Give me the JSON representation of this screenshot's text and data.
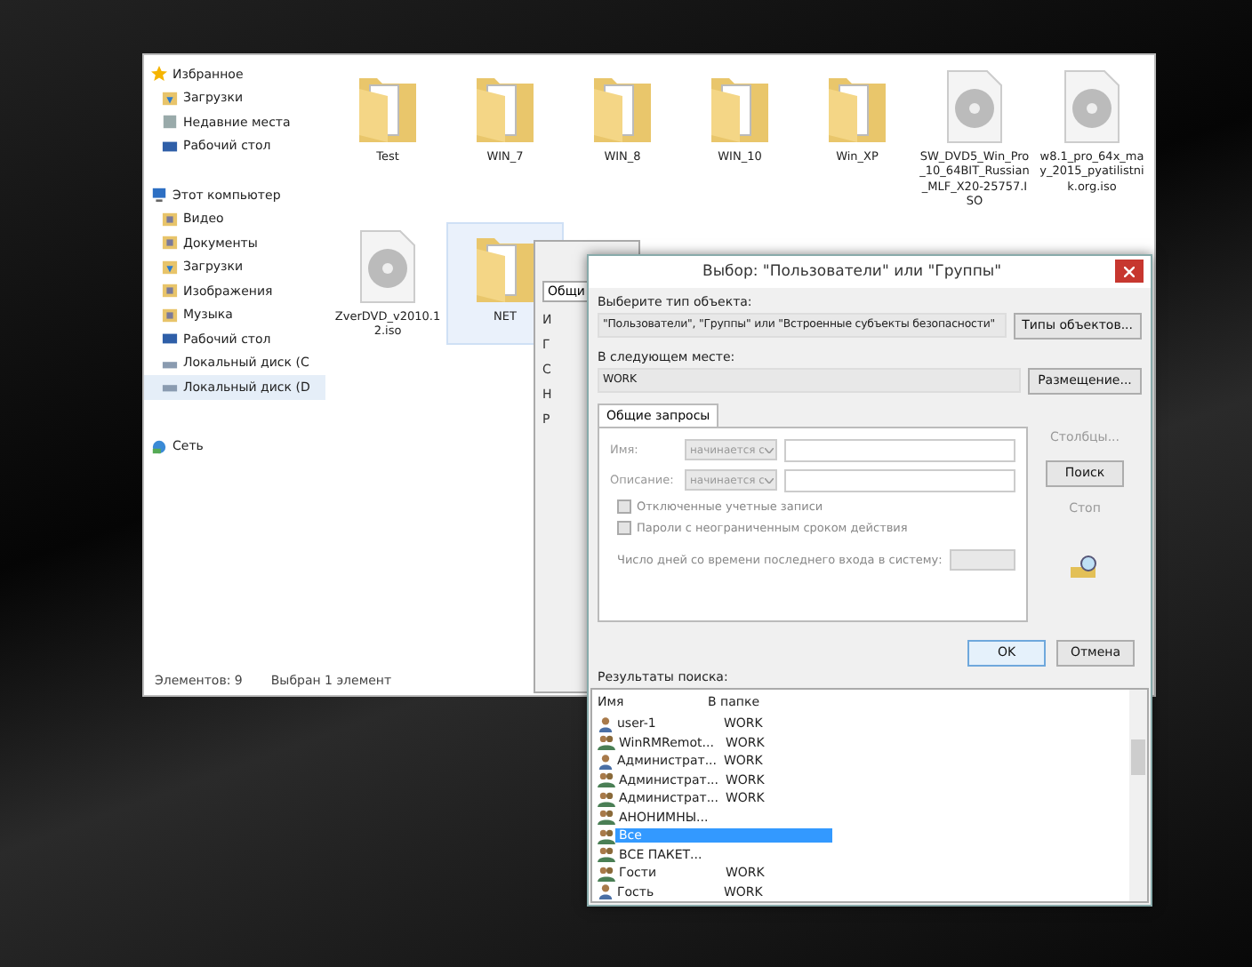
{
  "explorer": {
    "sidebar": [
      {
        "label": "Избранное",
        "kind": "star",
        "group": true,
        "selected": false
      },
      {
        "label": "Загрузки",
        "kind": "download",
        "group": false,
        "selected": false
      },
      {
        "label": "Недавние места",
        "kind": "recent",
        "group": false,
        "selected": false
      },
      {
        "label": "Рабочий стол",
        "kind": "desktop",
        "group": false,
        "selected": false
      },
      {
        "label": "Этот компьютер",
        "kind": "pc",
        "group": true,
        "selected": false
      },
      {
        "label": "Видео",
        "kind": "video",
        "group": false,
        "selected": false
      },
      {
        "label": "Документы",
        "kind": "docs",
        "group": false,
        "selected": false
      },
      {
        "label": "Загрузки",
        "kind": "download",
        "group": false,
        "selected": false
      },
      {
        "label": "Изображения",
        "kind": "images",
        "group": false,
        "selected": false
      },
      {
        "label": "Музыка",
        "kind": "music",
        "group": false,
        "selected": false
      },
      {
        "label": "Рабочий стол",
        "kind": "desktop",
        "group": false,
        "selected": false
      },
      {
        "label": "Локальный диск (C",
        "kind": "disk",
        "group": false,
        "selected": false
      },
      {
        "label": "Локальный диск (D",
        "kind": "disk",
        "group": false,
        "selected": true
      },
      {
        "label": "Сеть",
        "kind": "network",
        "group": true,
        "selected": false
      }
    ],
    "files": [
      [
        {
          "name": "Test",
          "kind": "folder",
          "selected": false
        },
        {
          "name": "WIN_7",
          "kind": "folder",
          "selected": false
        },
        {
          "name": "WIN_8",
          "kind": "folder",
          "selected": false
        },
        {
          "name": "WIN_10",
          "kind": "folder",
          "selected": false
        },
        {
          "name": "Win_XP",
          "kind": "folder",
          "selected": false
        },
        {
          "name": "SW_DVD5_Win_Pro_10_64BIT_Russian_MLF_X20-25757.ISO",
          "kind": "disc",
          "selected": false
        },
        {
          "name": "w8.1_pro_64x_may_2015_pyatilistnik.org.iso",
          "kind": "disc",
          "selected": false
        }
      ],
      [
        {
          "name": "ZverDVD_v2010.12.iso",
          "kind": "disc",
          "selected": false
        },
        {
          "name": "NET",
          "kind": "folder",
          "selected": true
        }
      ]
    ],
    "status": [
      "Элементов: 9",
      "Выбран 1 элемент"
    ]
  },
  "middle_window": {
    "tab": "Общи",
    "fragments": [
      "И",
      "Г",
      "С",
      "Н",
      "Р"
    ]
  },
  "dialog": {
    "title": "Выбор: \"Пользователи\" или \"Группы\"",
    "object_type_label": "Выберите тип объекта:",
    "object_type_value": "\"Пользователи\", \"Группы\" или \"Встроенные субъекты безопасности\"",
    "object_types_button": "Типы объектов...",
    "location_label": "В следующем месте:",
    "location_value": "WORK",
    "location_button": "Размещение...",
    "tab": "Общие запросы",
    "name_label": "Имя:",
    "name_mode": "начинается с",
    "desc_label": "Описание:",
    "desc_mode": "начинается с",
    "checks": [
      {
        "label": "Отключенные учетные записи",
        "checked": false
      },
      {
        "label": "Пароли с неограниченным сроком действия",
        "checked": false
      }
    ],
    "days_label": "Число дней со времени последнего входа в систему:",
    "side_buttons": [
      {
        "label": "Столбцы...",
        "disabled": true
      },
      {
        "label": "Поиск",
        "disabled": false
      },
      {
        "label": "Стоп",
        "disabled": true
      }
    ],
    "ok": "OK",
    "cancel": "Отмена",
    "results_label": "Результаты поиска:",
    "columns": [
      "Имя",
      "В папке"
    ],
    "rows": [
      {
        "name": "user-1",
        "folder": "WORK",
        "kind": "user",
        "selected": false
      },
      {
        "name": "WinRMRemot...",
        "folder": "WORK",
        "kind": "group",
        "selected": false
      },
      {
        "name": "Администрат...",
        "folder": "WORK",
        "kind": "user",
        "selected": false
      },
      {
        "name": "Администрат...",
        "folder": "WORK",
        "kind": "group",
        "selected": false
      },
      {
        "name": "Администрат...",
        "folder": "WORK",
        "kind": "group",
        "selected": false
      },
      {
        "name": "АНОНИМНЫ...",
        "folder": "",
        "kind": "group",
        "selected": false
      },
      {
        "name": "Все",
        "folder": "",
        "kind": "group",
        "selected": true
      },
      {
        "name": "ВСЕ ПАКЕТ...",
        "folder": "",
        "kind": "group",
        "selected": false
      },
      {
        "name": "Гости",
        "folder": "WORK",
        "kind": "group",
        "selected": false
      },
      {
        "name": "Гость",
        "folder": "WORK",
        "kind": "user",
        "selected": false
      }
    ]
  }
}
